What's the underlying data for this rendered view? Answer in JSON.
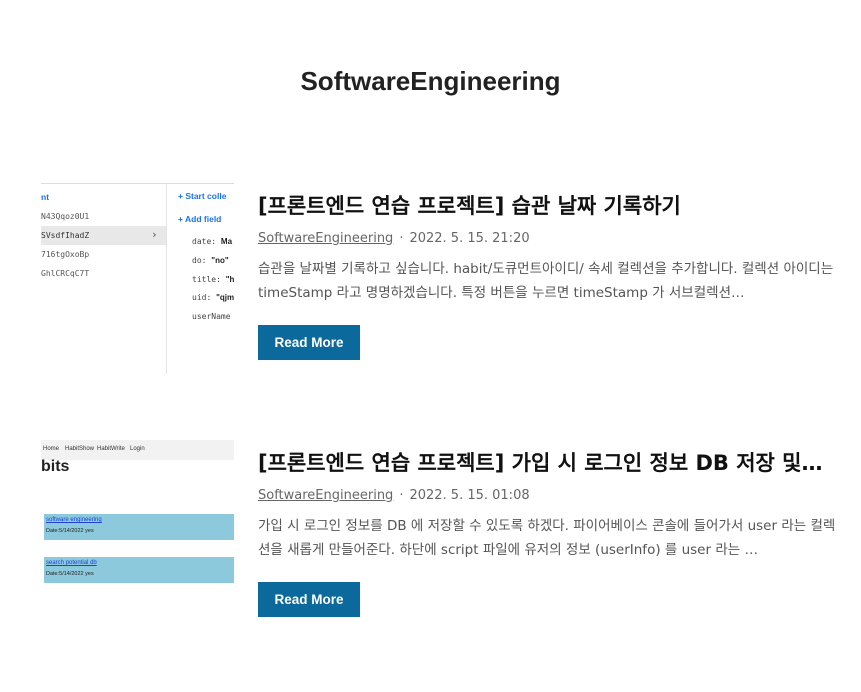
{
  "category": {
    "title": "SoftwareEngineering"
  },
  "posts": [
    {
      "title": "[프론트엔드 연습 프로젝트] 습관 날짜 기록하기",
      "category": "SoftwareEngineering",
      "separator": "·",
      "date": "2022. 5. 15. 21:20",
      "excerpt": "습관을 날짜별 기록하고 싶습니다. habit/도큐먼트아이디/ 속세 컬렉션을 추가합니다. 컬렉션 아이디는 timeStamp 라고 명명하겠습니다. 특정 버튼을 누르면 timeStamp 가 서브컬렉션…",
      "read_more": "Read More",
      "thumbnail": {
        "header_fragment": "nt",
        "doc_ids": [
          "N43Qqoz0U1",
          "SVsdfIhadZ",
          "716tgOxoBp",
          "GhlCRCqC7T"
        ],
        "selected_chevron": "›",
        "start_collection": "+ Start colle",
        "add_field": "+ Add field",
        "fields": [
          {
            "key": "date:",
            "value": "Ma"
          },
          {
            "key": "do:",
            "value": "\"no\""
          },
          {
            "key": "title:",
            "value": "\"h"
          },
          {
            "key": "uid:",
            "value": "\"qjm"
          },
          {
            "key": "userName",
            "value": ""
          }
        ]
      }
    },
    {
      "title": "[프론트엔드 연습 프로젝트] 가입 시 로그인 정보 DB 저장 및…",
      "category": "SoftwareEngineering",
      "separator": "·",
      "date": "2022. 5. 15. 01:08",
      "excerpt": "가입 시 로그인 정보를 DB 에 저장할 수 있도록 하겠다. 파이어베이스 콘솔에 들어가서 user 라는 컬렉션을 새롭게 만들어준다. 하단에 script 파일에 유저의 정보 (userInfo) 를 user 라는 …",
      "read_more": "Read More",
      "thumbnail": {
        "nav": [
          "Home",
          "HabitShow",
          "HabitWrite",
          "Login"
        ],
        "heading": "bits",
        "cards": [
          {
            "link": "software engineering",
            "date": "Date:5/14/2022 yes"
          },
          {
            "link": "search potential db",
            "date": "Date:5/14/2022 yes"
          }
        ]
      }
    }
  ],
  "colors": {
    "button": "#0b6a9b",
    "card": "#8cc9dc",
    "link_blue": "#1a73e8"
  }
}
